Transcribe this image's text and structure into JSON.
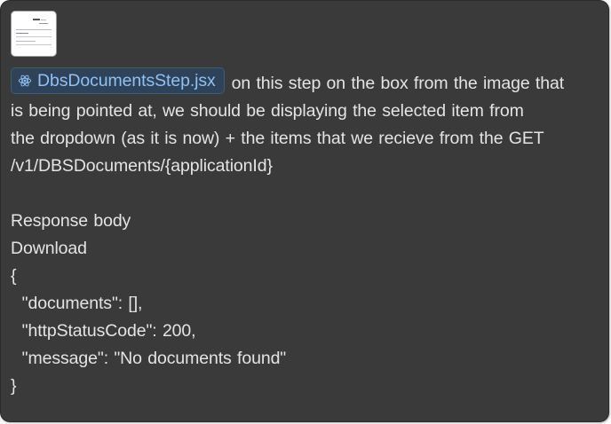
{
  "attachment": {
    "file_chip_label": "DbsDocumentsStep.jsx",
    "file_icon": "react-icon",
    "image_icon": "screenshot-thumbnail"
  },
  "message": {
    "intro_text": "on this step on the box from the image that",
    "lines": [
      "is being pointed at, we should be displaying the selected item from",
      "the dropdown (as it is now) + the items that we recieve from the GET",
      "/v1/DBSDocuments/{applicationId}"
    ],
    "response_lines": [
      "Response body",
      "Download",
      "{",
      "  \"documents\": [],",
      "  \"httpStatusCode\": 200,",
      "  \"message\": \"No documents found\"",
      "}"
    ]
  },
  "colors": {
    "background": "#3a3a3b",
    "text": "#e4e4e4",
    "chip_bg": "#2f4257",
    "chip_text": "#8ec1f6"
  }
}
